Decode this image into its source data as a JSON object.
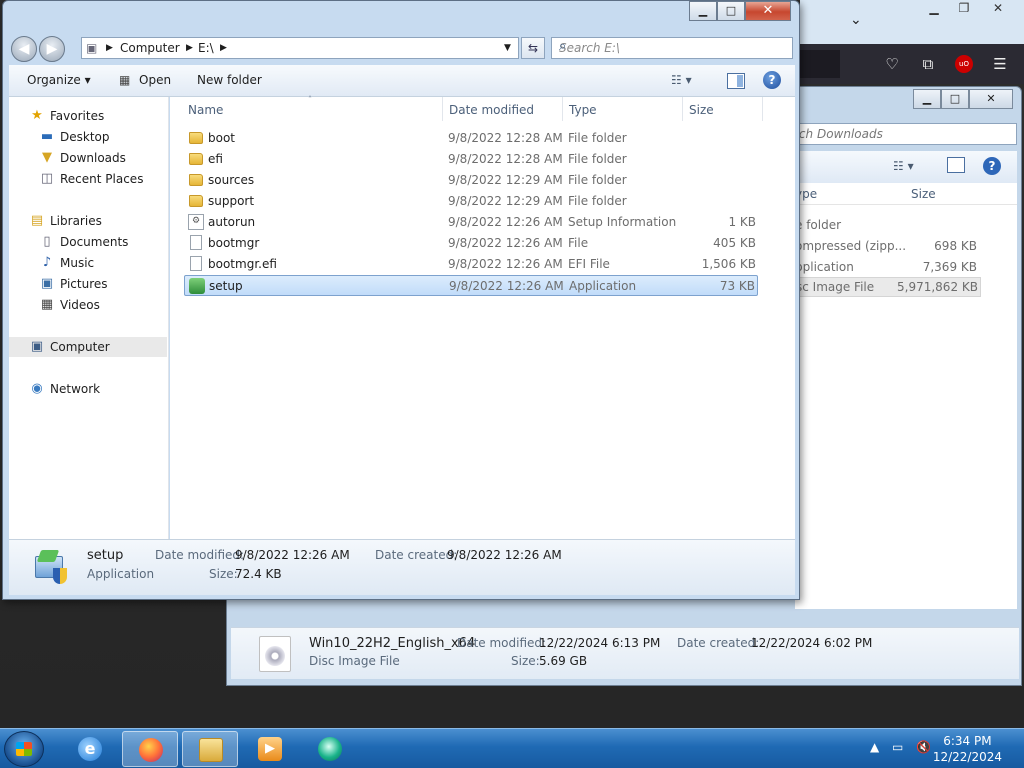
{
  "explorer": {
    "address": {
      "computer": "Computer",
      "drive": "E:\\"
    },
    "search_placeholder": "Search E:\\",
    "toolbar": {
      "organize": "Organize",
      "open": "Open",
      "new_folder": "New folder"
    },
    "nav": {
      "favorites": "Favorites",
      "desktop": "Desktop",
      "downloads": "Downloads",
      "recent": "Recent Places",
      "libraries": "Libraries",
      "documents": "Documents",
      "music": "Music",
      "pictures": "Pictures",
      "videos": "Videos",
      "computer": "Computer",
      "network": "Network"
    },
    "columns": {
      "name": "Name",
      "date": "Date modified",
      "type": "Type",
      "size": "Size"
    },
    "files": [
      {
        "name": "boot",
        "date": "9/8/2022 12:28 AM",
        "type": "File folder",
        "size": ""
      },
      {
        "name": "efi",
        "date": "9/8/2022 12:28 AM",
        "type": "File folder",
        "size": ""
      },
      {
        "name": "sources",
        "date": "9/8/2022 12:29 AM",
        "type": "File folder",
        "size": ""
      },
      {
        "name": "support",
        "date": "9/8/2022 12:29 AM",
        "type": "File folder",
        "size": ""
      },
      {
        "name": "autorun",
        "date": "9/8/2022 12:26 AM",
        "type": "Setup Information",
        "size": "1 KB"
      },
      {
        "name": "bootmgr",
        "date": "9/8/2022 12:26 AM",
        "type": "File",
        "size": "405 KB"
      },
      {
        "name": "bootmgr.efi",
        "date": "9/8/2022 12:26 AM",
        "type": "EFI File",
        "size": "1,506 KB"
      },
      {
        "name": "setup",
        "date": "9/8/2022 12:26 AM",
        "type": "Application",
        "size": "73 KB"
      }
    ],
    "details": {
      "name": "setup",
      "kind": "Application",
      "date_modified_label": "Date modified:",
      "date_modified": "9/8/2022 12:26 AM",
      "date_created_label": "Date created:",
      "date_created": "9/8/2022 12:26 AM",
      "size_label": "Size:",
      "size": "72.4 KB"
    }
  },
  "downloads_window": {
    "search_placeholder": "rch Downloads",
    "columns": {
      "type": "ype",
      "size": "Size"
    },
    "rows": [
      {
        "type": "e folder",
        "size": ""
      },
      {
        "type": "ompressed (zipp...",
        "size": "698 KB"
      },
      {
        "type": "pplication",
        "size": "7,369 KB"
      },
      {
        "type": "sc Image File",
        "size": "5,971,862 KB"
      }
    ],
    "details": {
      "name": "Win10_22H2_English_x64",
      "kind": "Disc Image File",
      "date_modified_label": "Date modified:",
      "date_modified": "12/22/2024 6:13 PM",
      "date_created_label": "Date created:",
      "date_created": "12/22/2024 6:02 PM",
      "size_label": "Size:",
      "size": "5.69 GB"
    }
  },
  "taskbar": {
    "time": "6:34 PM",
    "date": "12/22/2024"
  },
  "colors": {
    "selection": "#c1dcfa",
    "taskbar": "#1f6ab4",
    "window_frame": "#c7dbf0"
  }
}
